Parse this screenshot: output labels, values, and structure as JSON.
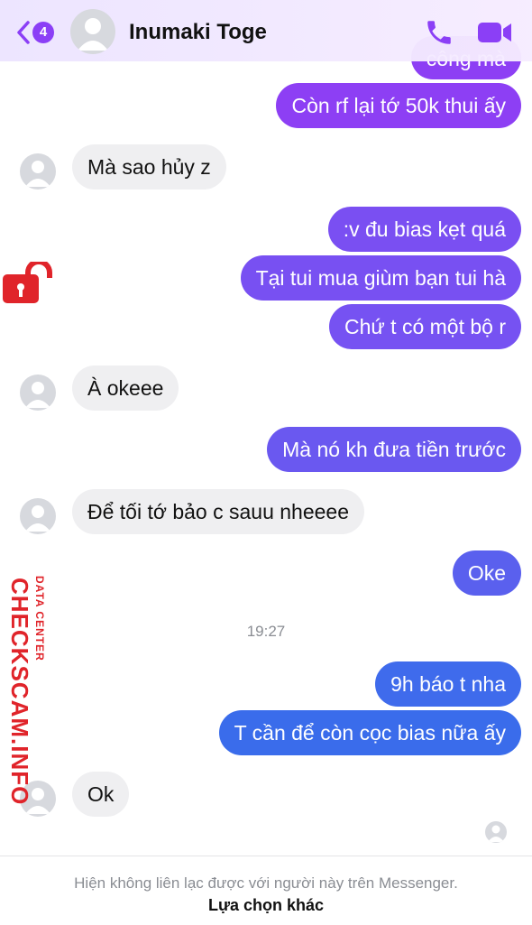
{
  "header": {
    "back_count": "4",
    "contact_name": "Inumaki Toge",
    "accent": "#8b3ff6"
  },
  "messages": [
    {
      "dir": "out",
      "text": "công mà",
      "color": "#8d3ff4"
    },
    {
      "dir": "out",
      "text": "Còn rf lại tớ 50k thui ấy",
      "color": "#8d3ff4"
    },
    {
      "dir": "in",
      "text": "Mà sao hủy z"
    },
    {
      "dir": "out",
      "text": ":v đu bias kẹt quá",
      "color": "#7a4ff2"
    },
    {
      "dir": "out",
      "text": "Tại tui mua giùm bạn tui hà",
      "color": "#7850f2"
    },
    {
      "dir": "out",
      "text": "Chứ t có một bộ r",
      "color": "#7652f2"
    },
    {
      "dir": "in",
      "text": "À okeee"
    },
    {
      "dir": "out",
      "text": "Mà nó kh đưa tiền trước",
      "color": "#6a58f0"
    },
    {
      "dir": "in",
      "text": "Để tối tớ bảo c sauu nheeee"
    },
    {
      "dir": "out",
      "text": "Oke",
      "color": "#5a60ee"
    },
    {
      "dir": "out",
      "text": "9h báo t nha",
      "color": "#3f6bec"
    },
    {
      "dir": "out",
      "text": "T cần để còn cọc bias nữa ấy",
      "color": "#3a6ceb"
    },
    {
      "dir": "in",
      "text": "Ok"
    }
  ],
  "timestamp": "19:27",
  "footer": {
    "notice": "Hiện không liên lạc được với người này trên Messenger.",
    "other_options": "Lựa chọn khác"
  },
  "watermark": {
    "brand": "CHECKSCAM.INFO",
    "sub": "DATA CENTER"
  }
}
